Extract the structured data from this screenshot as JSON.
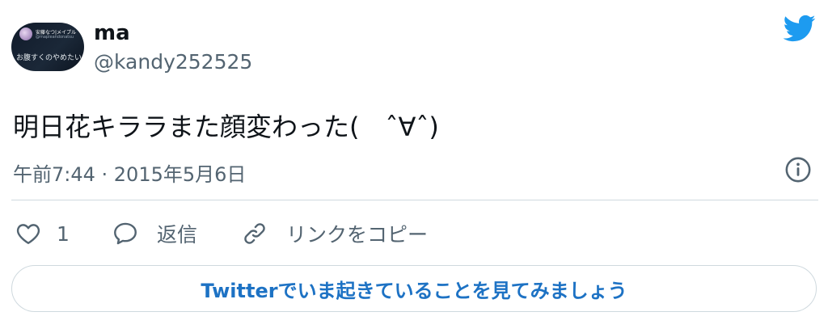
{
  "author": {
    "display_name": "ma",
    "handle": "@kandy252525",
    "avatar": {
      "name": "安藤なつ|メイプル",
      "handle": "@mapleandonatsu",
      "bio": "お腹すくのやめたい"
    }
  },
  "tweet": {
    "text": "明日花キララまた顔変わった(　ˆ∀ˆ)",
    "timestamp": "午前7:44 · 2015年5月6日"
  },
  "actions": {
    "like_count": "1",
    "reply_label": "返信",
    "copy_link_label": "リンクをコピー"
  },
  "cta_label": "Twitterでいま起きていることを見てみましょう",
  "colors": {
    "brand_blue": "#1d9bf0",
    "cta_text": "#1d72c4",
    "secondary_text": "#536471",
    "border": "#cfd9de"
  },
  "icons": [
    "twitter-bird-icon",
    "info-icon",
    "heart-icon",
    "reply-bubble-icon",
    "link-icon"
  ]
}
